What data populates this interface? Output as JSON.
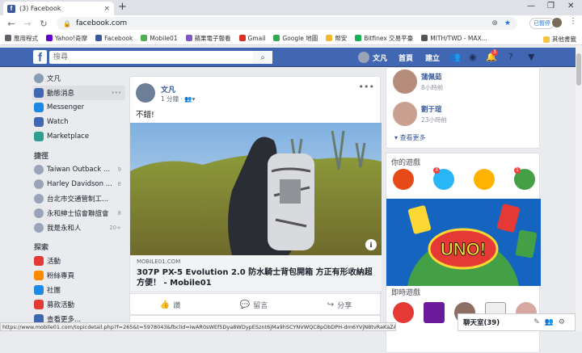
{
  "browser": {
    "tab_title": "(3) Facebook",
    "tab_close": "×",
    "new_tab": "+",
    "url": "facebook.com",
    "profile_label": "已暫停",
    "window_controls": [
      "—",
      "❐",
      "✕"
    ],
    "bookmarks": [
      {
        "label": "應用程式",
        "color": "#5f6368"
      },
      {
        "label": "Yahoo!奇摩",
        "color": "#6001d2"
      },
      {
        "label": "Facebook",
        "color": "#3b5998"
      },
      {
        "label": "Mobile01",
        "color": "#4caf50"
      },
      {
        "label": "蘋果電子報看",
        "color": "#7e57c2"
      },
      {
        "label": "Gmail",
        "color": "#d93025"
      },
      {
        "label": "Google 地圖",
        "color": "#34a853"
      },
      {
        "label": "幣安",
        "color": "#f3ba2f"
      },
      {
        "label": "Bitfinex 交易平臺",
        "color": "#16b157"
      },
      {
        "label": "MITH/TWD - MAX...",
        "color": "#555555"
      }
    ],
    "bookmarks_other": "其他書籤",
    "status_url": "https://www.mobile01.com/topicdetail.php?f=265&t=5978043&fbclid=IwAR0sWEf5Dya8WDypESznt6jMa9hSCYNVWQC8pObDPH-dm6YVjN8tvRaKaZAE"
  },
  "fb": {
    "logo": "f",
    "search_placeholder": "搜尋",
    "user_name": "文凡",
    "nav_home": "首頁",
    "nav_create": "建立",
    "notification_count": "3",
    "brand_color": "#4267b2"
  },
  "leftnav": {
    "user": "文凡",
    "items": [
      {
        "label": "動態消息",
        "color": "#4267b2",
        "active": true
      },
      {
        "label": "Messenger",
        "color": "#1e88e5"
      },
      {
        "label": "Watch",
        "color": "#4267b2"
      },
      {
        "label": "Marketplace",
        "color": "#2e9e8f"
      }
    ],
    "shortcuts_title": "捷徑",
    "shortcuts": [
      {
        "label": "Taiwan Outback ...",
        "count": "9"
      },
      {
        "label": "Harley Davidson ...",
        "count": "8"
      },
      {
        "label": "台北市交通管制工...",
        "count": ""
      },
      {
        "label": "永和紳士協會聯誼會",
        "count": "8"
      },
      {
        "label": "我是永和人",
        "count": "20+"
      }
    ],
    "explore_title": "探索",
    "explore": [
      {
        "label": "活動",
        "color": "#e53935"
      },
      {
        "label": "粉絲專頁",
        "color": "#fb8c00"
      },
      {
        "label": "社團",
        "color": "#1e88e5"
      },
      {
        "label": "募款活動",
        "color": "#e53935"
      },
      {
        "label": "查看更多...",
        "color": "#4267b2"
      }
    ]
  },
  "post": {
    "author": "文凡",
    "time": "1 分鐘",
    "text": "不錯!",
    "link_domain": "MOBILE01.COM",
    "link_title": "307P PX-5 Evolution 2.0 防水騎士背包開箱 方正有形收納超方便！ - Mobile01",
    "like": "讚",
    "comment": "留言",
    "share": "分享"
  },
  "right": {
    "friends": [
      {
        "name": "蒲佩茹",
        "sub": "8小時前"
      },
      {
        "name": "劉于瑄",
        "sub": "23小時前"
      }
    ],
    "see_more": "查看更多",
    "games_title": "你的遊戲",
    "game_badges": [
      "3",
      "1"
    ],
    "instant_title": "即時遊戲"
  },
  "chat": {
    "label": "聊天室(39)"
  }
}
